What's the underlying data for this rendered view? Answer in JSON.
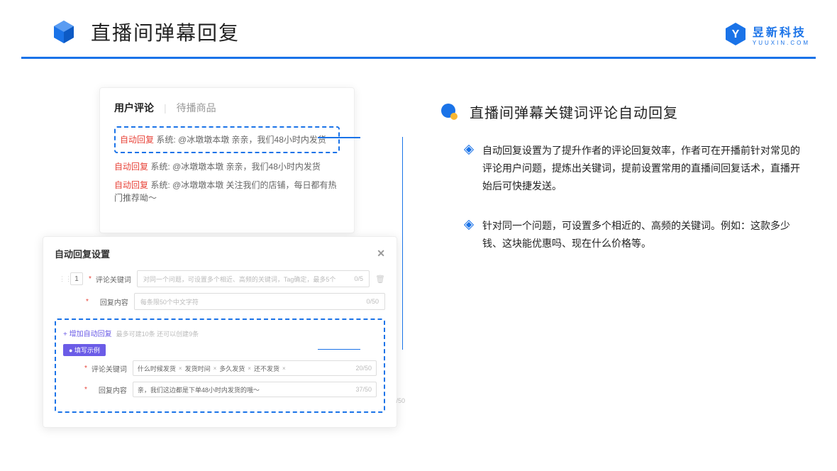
{
  "header": {
    "title": "直播间弹幕回复"
  },
  "brand": {
    "name": "昱新科技",
    "sub": "YUUXIN.COM"
  },
  "commentCard": {
    "tabs": {
      "active": "用户评论",
      "inactive": "待播商品"
    },
    "highlighted": {
      "tag": "自动回复",
      "text": " 系统: @冰墩墩本墩 亲亲，我们48小时内发货"
    },
    "line2": {
      "tag": "自动回复",
      "text": " 系统: @冰墩墩本墩 亲亲，我们48小时内发货"
    },
    "line3": {
      "tag": "自动回复",
      "text": " 系统: @冰墩墩本墩 关注我们的店铺，每日都有热门推荐呦～"
    }
  },
  "settings": {
    "title": "自动回复设置",
    "idx": "1",
    "label1": "评论关键词",
    "placeholder1": "对同一个问题，可设置多个相近、高频的关键词，Tag确定，最多5个",
    "counter1": "0/5",
    "label2": "回复内容",
    "placeholder2": "每条限50个中文字符",
    "counter2": "0/50",
    "addLink": "+ 增加自动回复",
    "addHint": "最多可建10条 还可以创建9条",
    "badge": "● 填写示例",
    "exLabel1": "评论关键词",
    "tags": [
      "什么时候发货",
      "发货时间",
      "多久发货",
      "还不发货"
    ],
    "exCounter1": "20/50",
    "exLabel2": "回复内容",
    "exValue2": "亲，我们这边都是下单48小时内发货的哦～",
    "exCounter2": "37/50",
    "extraCounter": "/50"
  },
  "right": {
    "title": "直播间弹幕关键词评论自动回复",
    "b1": "自动回复设置为了提升作者的评论回复效率，作者可在开播前针对常见的评论用户问题，提炼出关键词，提前设置常用的直播间回复话术，直播开始后可快捷发送。",
    "b2": "针对同一个问题，可设置多个相近的、高频的关键词。例如：这款多少钱、这块能优惠吗、现在什么价格等。"
  }
}
